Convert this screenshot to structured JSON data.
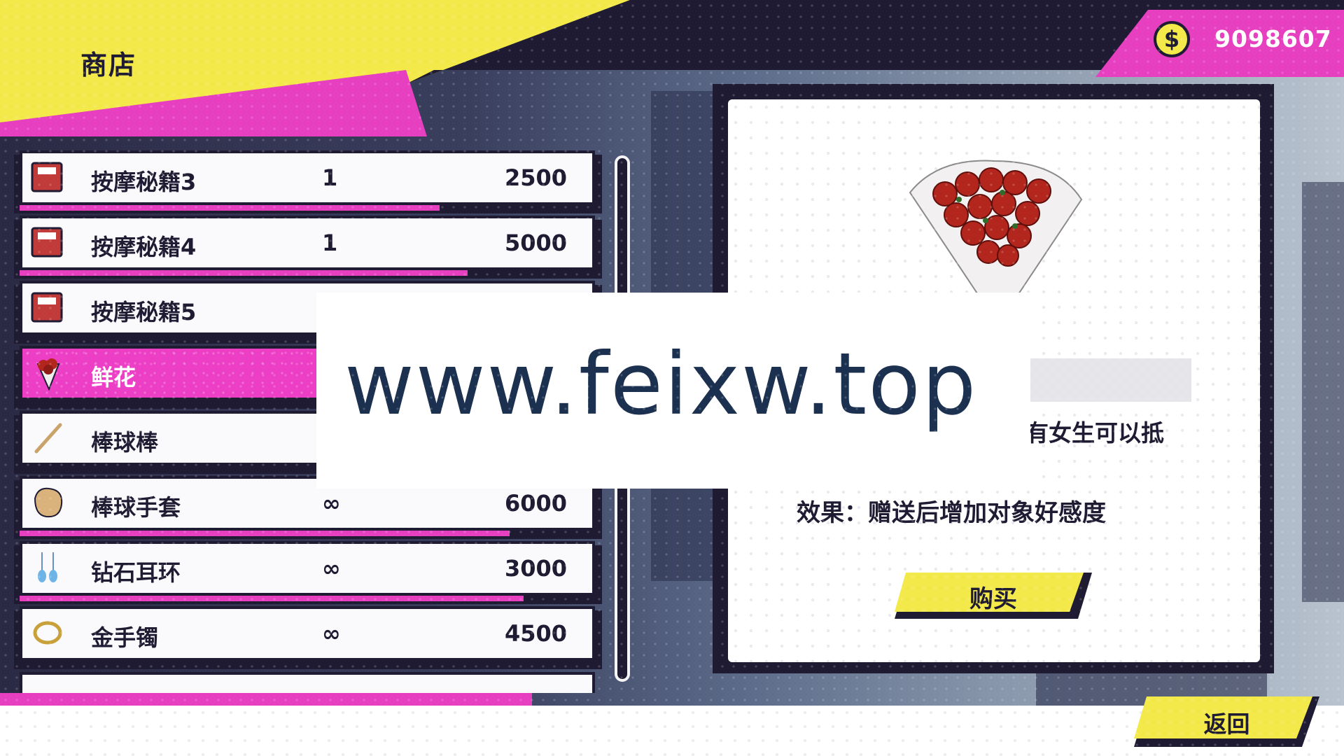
{
  "header": {
    "title": "商店"
  },
  "currency": {
    "icon": "dollar-coin-icon",
    "symbol": "$",
    "amount": "9098607"
  },
  "shop_items": [
    {
      "name": "按摩秘籍3",
      "qty": "1",
      "price": "2500",
      "icon": "book-icon"
    },
    {
      "name": "按摩秘籍4",
      "qty": "1",
      "price": "5000",
      "icon": "book-icon"
    },
    {
      "name": "按摩秘籍5",
      "qty": "",
      "price": "",
      "icon": "book-icon"
    },
    {
      "name": "鲜花",
      "qty": "",
      "price": "",
      "icon": "rose-bouquet-icon",
      "selected": true
    },
    {
      "name": "棒球棒",
      "qty": "",
      "price": "",
      "icon": "baseball-bat-icon"
    },
    {
      "name": "棒球手套",
      "qty": "∞",
      "price": "6000",
      "icon": "baseball-glove-icon"
    },
    {
      "name": "钻石耳环",
      "qty": "∞",
      "price": "3000",
      "icon": "earring-icon"
    },
    {
      "name": "金手镯",
      "qty": "∞",
      "price": "4500",
      "icon": "bracelet-icon"
    }
  ],
  "detail": {
    "image": "rose-bouquet-icon",
    "description": "有女生可以抵",
    "effect": "效果：赠送后增加对象好感度",
    "buy_label": "购买"
  },
  "watermark": "www.feixw.top",
  "footer": {
    "back_label": "返回"
  },
  "colors": {
    "navy": "#1e1b33",
    "yellow": "#f3e94a",
    "magenta": "#e63fbf"
  }
}
